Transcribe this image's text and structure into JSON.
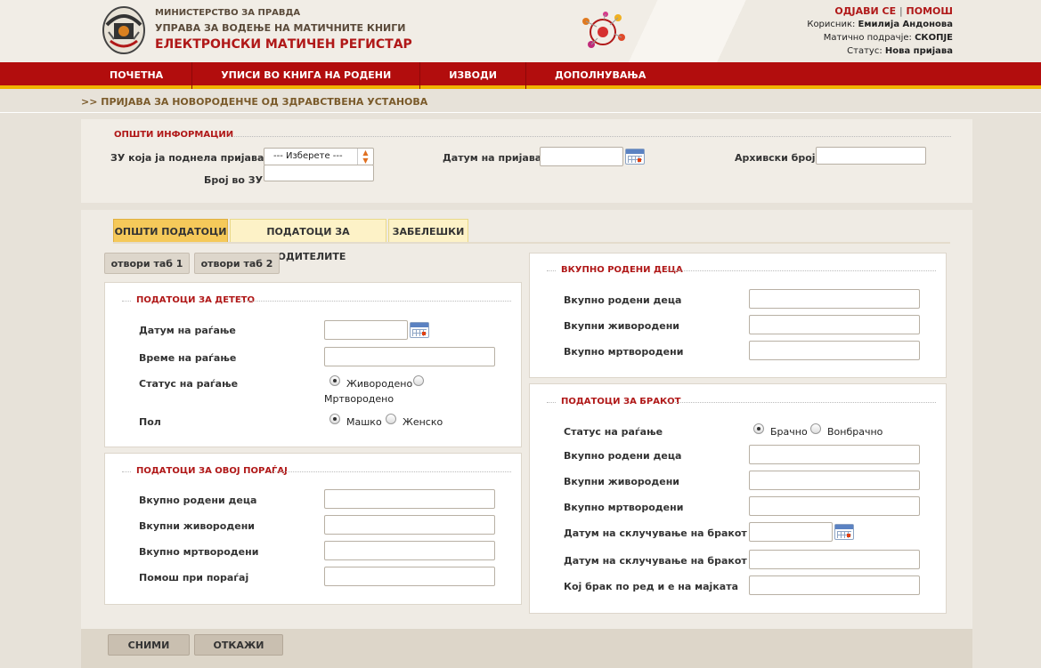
{
  "header": {
    "ministry": "МИНИСТЕРСТВО ЗА ПРАВДА",
    "office": "УПРАВА ЗА ВОДЕЊЕ НА МАТИЧНИТЕ КНИГИ",
    "app_title": "ЕЛЕКТРОНСКИ МАТИЧЕН РЕГИСТАР",
    "logout": "ОДЈАВИ СЕ",
    "separator": "|",
    "help": "ПОМОШ",
    "user_label": "Корисник:",
    "user_value": "Емилија Андонова",
    "area_label": "Матично подрачје:",
    "area_value": "СКОПЈЕ",
    "status_label": "Статус:",
    "status_value": "Нова пријава",
    "logo_icon": "coat-of-arms-icon",
    "emblem_icon": "registry-emblem-icon"
  },
  "nav": {
    "items": [
      "ПОЧЕТНА",
      "УПИСИ ВО КНИГА НА РОДЕНИ",
      "ИЗВОДИ",
      "ДОПОЛНУВАЊА"
    ]
  },
  "breadcrumb": ">> ПРИЈАВА ЗА НОВОРОДЕНЧЕ ОД ЗДРАВСТВЕНА УСТАНОВА",
  "general": {
    "legend": "ОПШТИ ИНФОРМАЦИИ",
    "zu_label": "ЗУ која ја поднела пријавата",
    "zu_select_value": "--- Изберете ---",
    "zu_number_label": "Број во ЗУ",
    "zu_number_value": "",
    "date_label": "Датум на пријава",
    "date_value": "",
    "archive_label": "Архивски број",
    "archive_value": ""
  },
  "tabs": [
    "ОПШТИ ПОДАТОЦИ",
    "ПОДАТОЦИ ЗА РОДИТЕЛИТЕ",
    "ЗАБЕЛЕШКИ"
  ],
  "tab_buttons": [
    "отвори таб 1",
    "отвори таб 2"
  ],
  "child": {
    "legend": "ПОДАТОЦИ ЗА ДЕТЕТО",
    "birth_date": "Датум на раѓање",
    "birth_time": "Време на раѓање",
    "birth_status": "Статус на раѓање",
    "alive": "Живородено",
    "stillborn": "Мртвородено",
    "sex": "Пол",
    "male": "Машко",
    "female": "Женско"
  },
  "delivery": {
    "legend": "ПОДАТОЦИ ЗА ОВОЈ ПОРАЃАЈ",
    "total": "Вкупно родени деца",
    "alive": "Вкупни живородени",
    "dead": "Вкупно мртвородени",
    "help": "Помош при пораѓај"
  },
  "totals": {
    "legend": "ВКУПНО РОДЕНИ ДЕЦА",
    "total": "Вкупно родени деца",
    "alive": "Вкупни живородени",
    "dead": "Вкупно мртвородени"
  },
  "marriage": {
    "legend": "ПОДАТОЦИ ЗА БРАКОТ",
    "birth_status": "Статус на раѓање",
    "marital": "Брачно",
    "extramarital": "Вонбрачно",
    "total": "Вкупно родени деца",
    "alive": "Вкупни живородени",
    "dead": "Вкупно мртвородени",
    "marriage_date": "Датум на склучување на бракот",
    "marriage_date2": "Датум на склучување на бракот",
    "marriage_order": "Кој брак по ред и е на мајката"
  },
  "footer": {
    "save": "СНИМИ",
    "cancel": "ОТКАЖИ"
  },
  "colors": {
    "nav_bg": "#b20d0d",
    "nav_accent": "#f0b400",
    "title_red": "#b01818",
    "tab_active": "#f5c95a",
    "tab_inactive": "#fdf2c7"
  }
}
